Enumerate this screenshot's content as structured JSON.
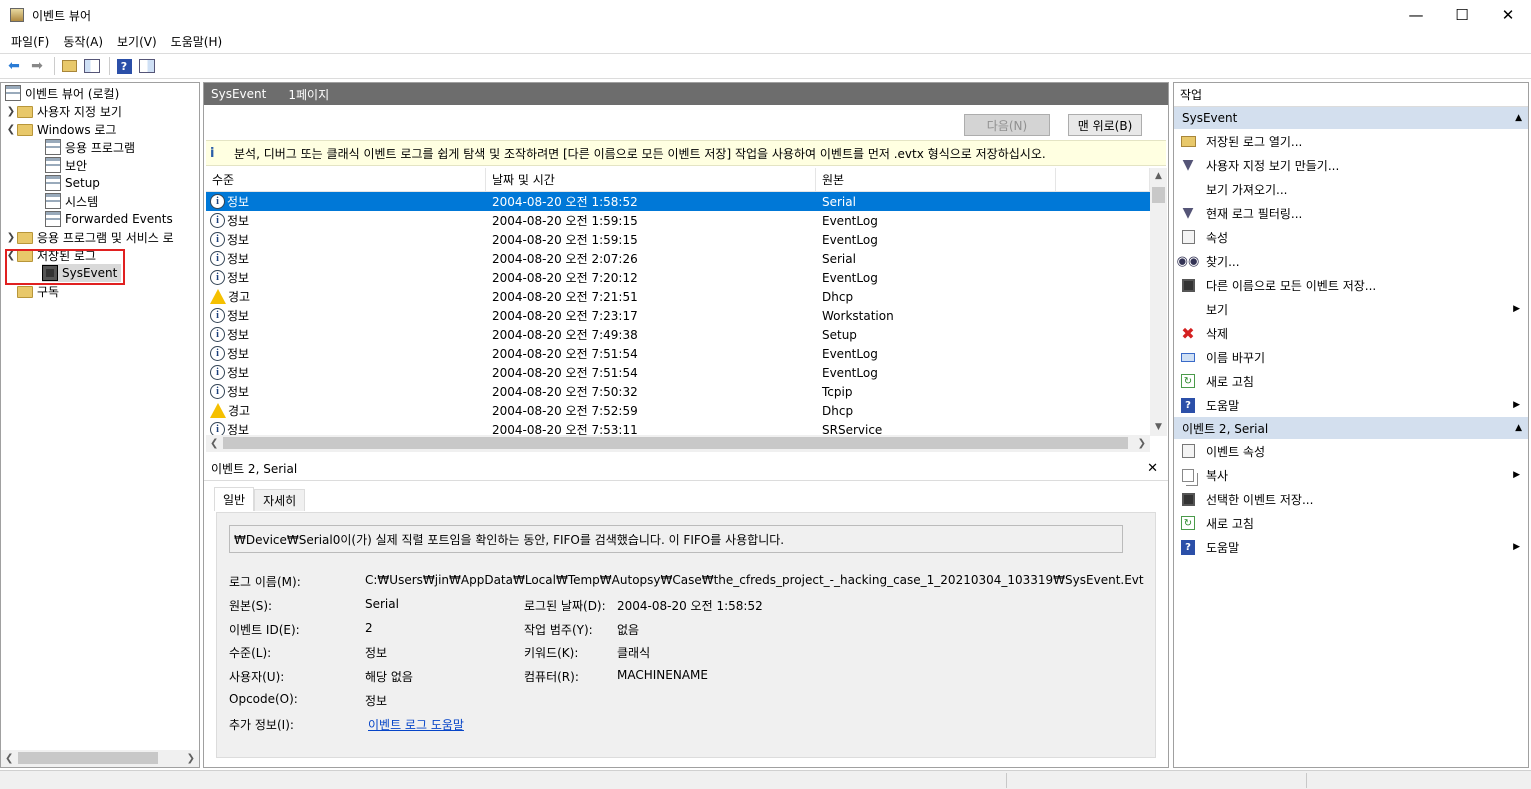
{
  "window": {
    "title": "이벤트 뷰어"
  },
  "menu": [
    "파일(F)",
    "동작(A)",
    "보기(V)",
    "도움말(H)"
  ],
  "tree": {
    "root": "이벤트 뷰어 (로컬)",
    "custom_views": "사용자 지정 보기",
    "windows_logs": "Windows 로그",
    "windows_children": [
      "응용 프로그램",
      "보안",
      "Setup",
      "시스템",
      "Forwarded Events"
    ],
    "app_service_logs": "응용 프로그램 및 서비스 로",
    "saved_logs": "저장된 로그",
    "sysevent": "SysEvent",
    "subscriptions": "구독"
  },
  "center": {
    "header_title": "SysEvent",
    "header_page": "1페이지",
    "next_button": "다음(N)",
    "top_button": "맨 위로(B)",
    "info_text": "분석, 디버그 또는 클래식 이벤트 로그를 쉽게 탐색 및 조작하려면 [다른 이름으로 모든 이벤트 저장] 작업을 사용하여 이벤트를 먼저 .evtx 형식으로 저장하십시오.",
    "columns": [
      "수준",
      "날짜 및 시간",
      "원본"
    ],
    "rows": [
      {
        "level": "정보",
        "type": "info",
        "date": "2004-08-20 오전 1:58:52",
        "source": "Serial"
      },
      {
        "level": "정보",
        "type": "info",
        "date": "2004-08-20 오전 1:59:15",
        "source": "EventLog"
      },
      {
        "level": "정보",
        "type": "info",
        "date": "2004-08-20 오전 1:59:15",
        "source": "EventLog"
      },
      {
        "level": "정보",
        "type": "info",
        "date": "2004-08-20 오전 2:07:26",
        "source": "Serial"
      },
      {
        "level": "정보",
        "type": "info",
        "date": "2004-08-20 오전 7:20:12",
        "source": "EventLog"
      },
      {
        "level": "경고",
        "type": "warn",
        "date": "2004-08-20 오전 7:21:51",
        "source": "Dhcp"
      },
      {
        "level": "정보",
        "type": "info",
        "date": "2004-08-20 오전 7:23:17",
        "source": "Workstation"
      },
      {
        "level": "정보",
        "type": "info",
        "date": "2004-08-20 오전 7:49:38",
        "source": "Setup"
      },
      {
        "level": "정보",
        "type": "info",
        "date": "2004-08-20 오전 7:51:54",
        "source": "EventLog"
      },
      {
        "level": "정보",
        "type": "info",
        "date": "2004-08-20 오전 7:51:54",
        "source": "EventLog"
      },
      {
        "level": "정보",
        "type": "info",
        "date": "2004-08-20 오전 7:50:32",
        "source": "Tcpip"
      },
      {
        "level": "경고",
        "type": "warn",
        "date": "2004-08-20 오전 7:52:59",
        "source": "Dhcp"
      },
      {
        "level": "정보",
        "type": "info",
        "date": "2004-08-20 오전 7:53:11",
        "source": "SRService"
      }
    ]
  },
  "detail": {
    "title": "이벤트 2, Serial",
    "tab_general": "일반",
    "tab_details": "자세히",
    "message": "₩Device₩Serial0이(가) 실제 직렬 포트임을 확인하는 동안, FIFO를 검색했습니다. 이 FIFO를 사용합니다.",
    "log_name_label": "로그 이름(M):",
    "log_name_value": "C:₩Users₩jin₩AppData₩Local₩Temp₩Autopsy₩Case₩the_cfreds_project_-_hacking_case_1_20210304_103319₩SysEvent.Evt",
    "source_label": "원본(S):",
    "source_value": "Serial",
    "logged_label": "로그된 날짜(D):",
    "logged_value": "2004-08-20 오전 1:58:52",
    "event_id_label": "이벤트 ID(E):",
    "event_id_value": "2",
    "task_label": "작업 범주(Y):",
    "task_value": "없음",
    "level_label": "수준(L):",
    "level_value": "정보",
    "keywords_label": "키워드(K):",
    "keywords_value": "클래식",
    "user_label": "사용자(U):",
    "user_value": "해당 없음",
    "computer_label": "컴퓨터(R):",
    "computer_value": "MACHINENAME",
    "opcode_label": "Opcode(O):",
    "opcode_value": "정보",
    "more_label": "추가 정보(I):",
    "more_link": "이벤트 로그 도움말"
  },
  "actions": {
    "header": "작업",
    "section1": "SysEvent",
    "items1": [
      "저장된 로그 열기...",
      "사용자 지정 보기 만들기...",
      "보기 가져오기...",
      "현재 로그 필터링...",
      "속성",
      "찾기...",
      "다른 이름으로 모든 이벤트 저장...",
      "보기",
      "삭제",
      "이름 바꾸기",
      "새로 고침",
      "도움말"
    ],
    "section2": "이벤트 2, Serial",
    "items2": [
      "이벤트 속성",
      "복사",
      "선택한 이벤트 저장...",
      "새로 고침",
      "도움말"
    ]
  }
}
